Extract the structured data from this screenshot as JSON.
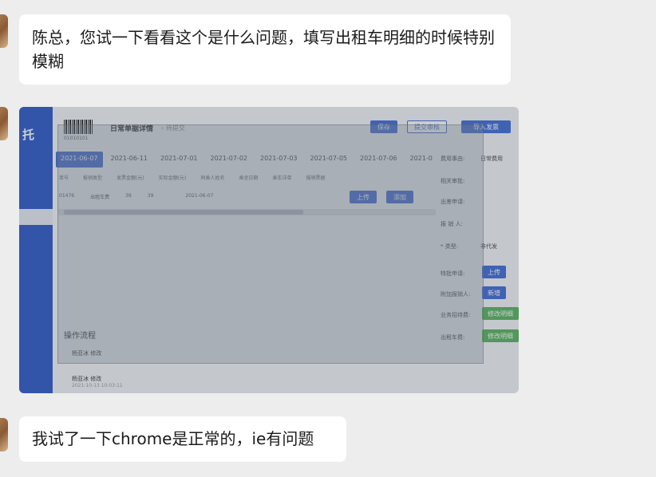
{
  "messages": [
    {
      "text": "陈总，您试一下看看这个是什么问题，填写出租车明细的时候特别模糊"
    },
    {
      "text": "我试了一下chrome是正常的，ie有问题"
    }
  ],
  "screenshot": {
    "brand": "托",
    "barcode_number": "01010101",
    "title": "日常单据详情",
    "status": "› 待提交",
    "buttons": {
      "save": "保存",
      "submit": "提交审核",
      "import": "导入发票"
    },
    "tabs": [
      "2021-06-07",
      "2021-06-11",
      "2021-07-01",
      "2021-07-02",
      "2021-07-03",
      "2021-07-05",
      "2021-07-06",
      "2021-0"
    ],
    "table_headers": [
      "单号",
      "报销类型",
      "发票金额(元)",
      "实际金额(元)",
      "同乘人姓名",
      "乘坐日期",
      "乘车详单",
      "报销票据"
    ],
    "table_row": [
      "01476",
      "出租车费",
      "39",
      "39",
      "",
      "2021-06-07"
    ],
    "row_buttons": {
      "upload": "上传",
      "add": "添加"
    },
    "flow_title": "操作流程",
    "flow_items": [
      "杨亚冰  修改",
      "杨亚冰  修改"
    ],
    "flow_time": "2021-10-13 10:03:11",
    "right_labels": [
      "费用事由:",
      "相关审批:",
      "出差申请:",
      "报 销 人:",
      "* 类型:",
      "特批申请:",
      "附加报销人:",
      "业务招待费:",
      "出租车费:"
    ],
    "right_values": [
      "日常费用",
      "",
      "",
      "",
      "非代发"
    ],
    "right_buttons": {
      "upload": "上传",
      "add": "新增",
      "edit1": "修改明细",
      "edit2": "修改明细"
    },
    "colors": {
      "sidebar": "#2d58c7",
      "primary": "#3d6ad6",
      "green": "#58b35a"
    }
  }
}
